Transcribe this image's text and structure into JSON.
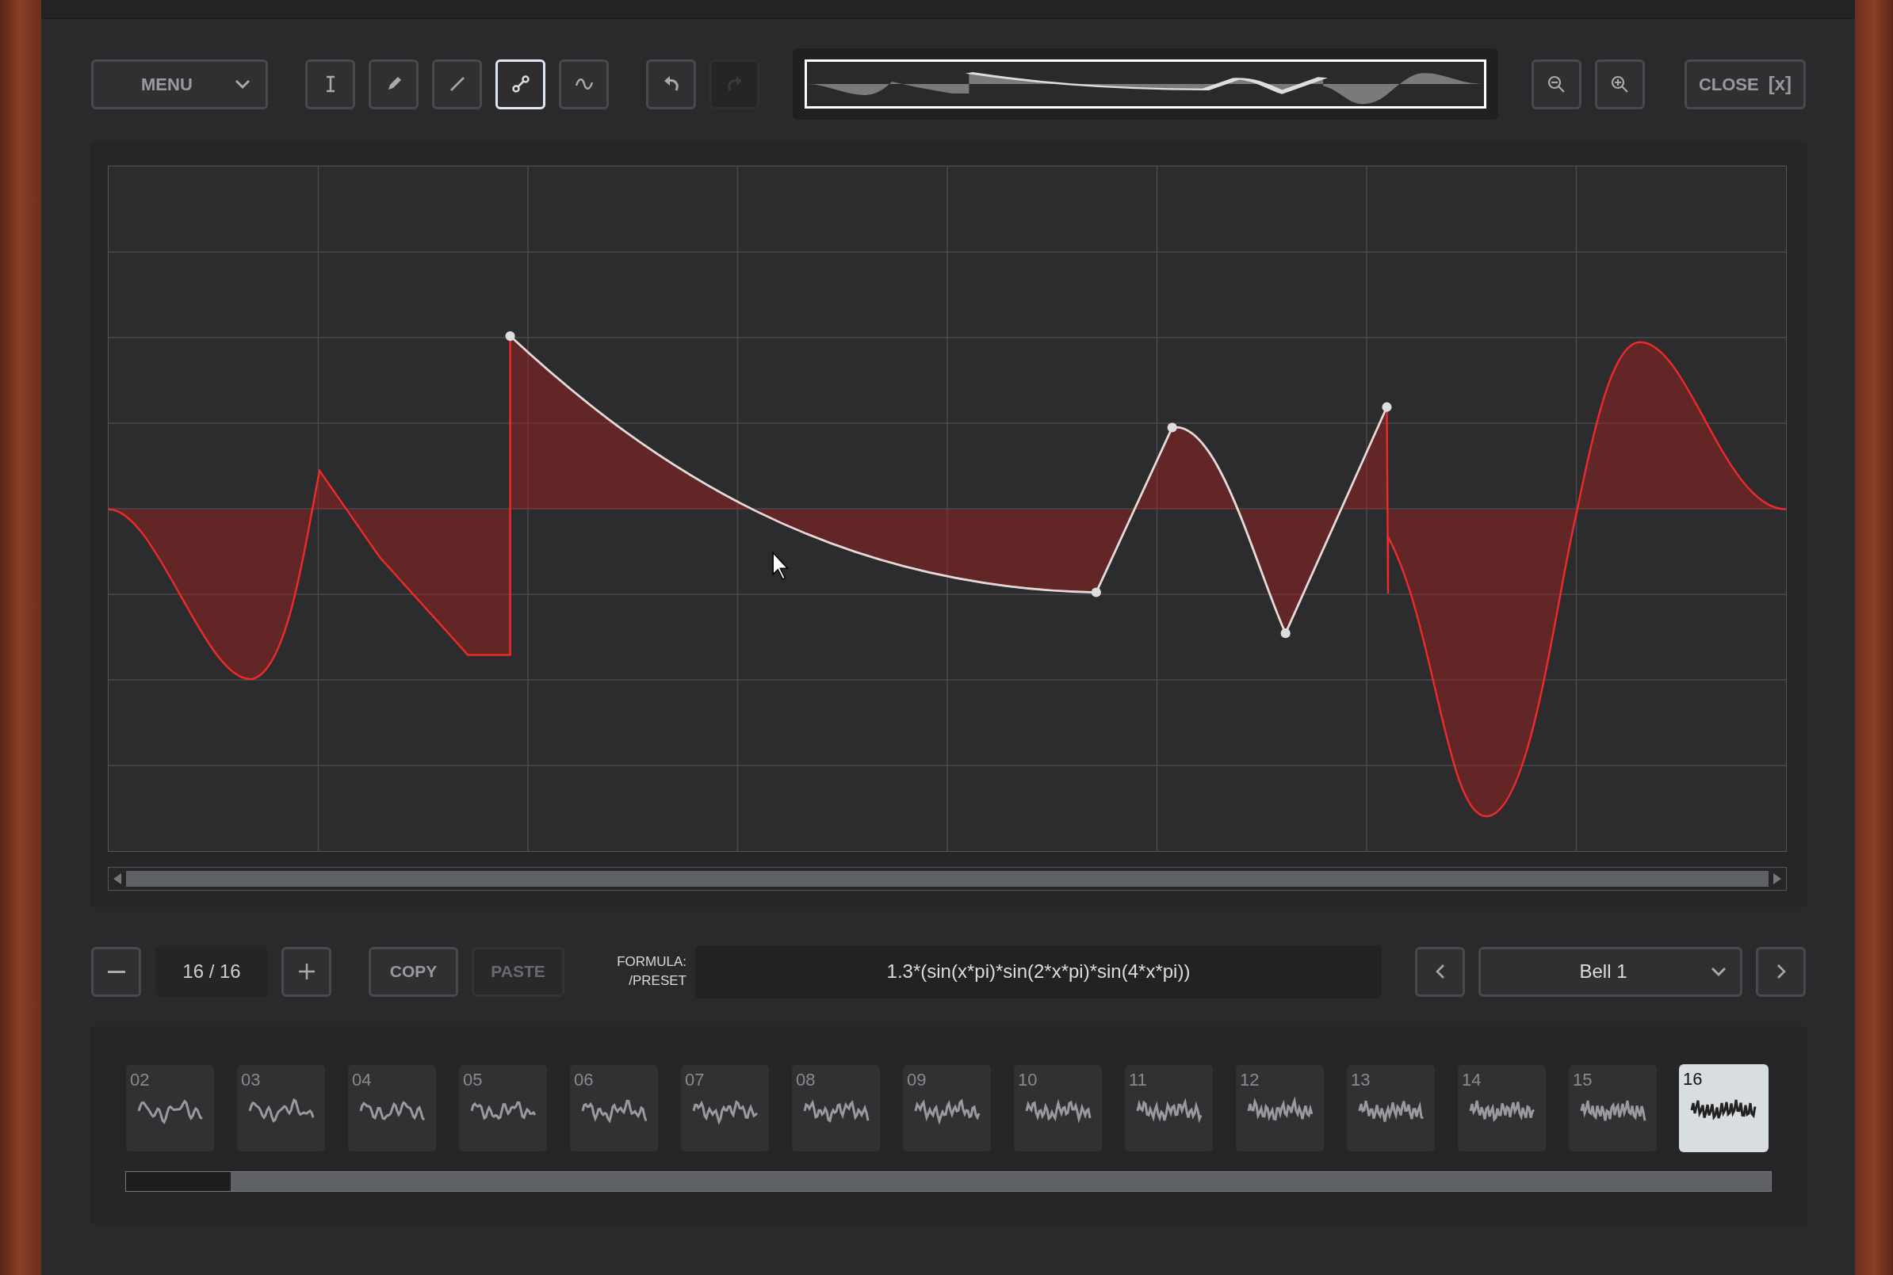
{
  "toolbar": {
    "menu": "MENU",
    "tools": [
      {
        "kind": "text",
        "selected": false
      },
      {
        "kind": "pencil",
        "selected": false
      },
      {
        "kind": "line",
        "selected": false
      },
      {
        "kind": "node",
        "selected": true
      },
      {
        "kind": "curve",
        "selected": false
      }
    ],
    "undo": {
      "disabled": false
    },
    "redo": {
      "disabled": true
    },
    "close_label": "CLOSE",
    "close_glyph": "[x]"
  },
  "controls": {
    "counter": "16 / 16",
    "copy": {
      "label": "COPY",
      "disabled": false
    },
    "paste": {
      "label": "PASTE",
      "disabled": true
    },
    "formula_label": "FORMULA:\n/PRESET",
    "formula": "1.3*(sin(x*pi)*sin(2*x*pi)*sin(4*x*pi))",
    "preset": "Bell 1"
  },
  "thumbnails": [
    {
      "label": "02",
      "selected": false
    },
    {
      "label": "03",
      "selected": false
    },
    {
      "label": "04",
      "selected": false
    },
    {
      "label": "05",
      "selected": false
    },
    {
      "label": "06",
      "selected": false
    },
    {
      "label": "07",
      "selected": false
    },
    {
      "label": "08",
      "selected": false
    },
    {
      "label": "09",
      "selected": false
    },
    {
      "label": "10",
      "selected": false
    },
    {
      "label": "11",
      "selected": false
    },
    {
      "label": "12",
      "selected": false
    },
    {
      "label": "13",
      "selected": false
    },
    {
      "label": "14",
      "selected": false
    },
    {
      "label": "15",
      "selected": false
    },
    {
      "label": "16",
      "selected": true
    }
  ]
}
